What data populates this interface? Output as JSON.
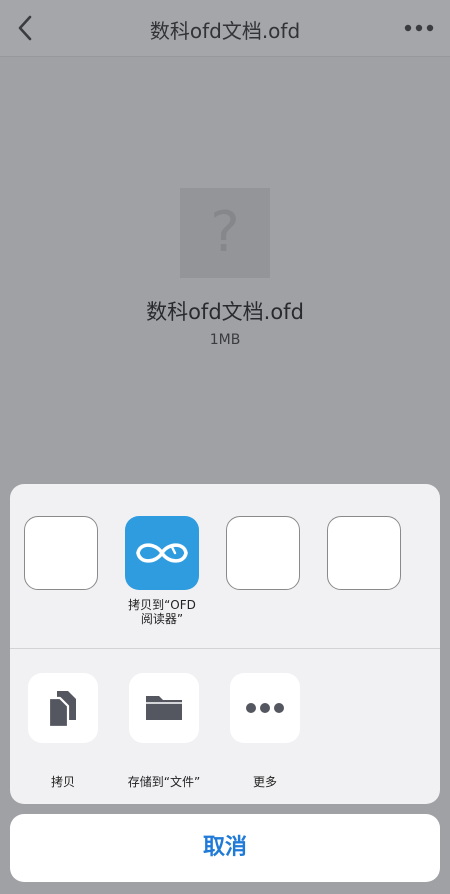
{
  "navbar": {
    "title": "数科ofd文档.ofd",
    "back_icon": "chevron-left-icon",
    "more_icon": "ellipsis-icon"
  },
  "file": {
    "name": "数科ofd文档.ofd",
    "size": "1MB",
    "preview_icon": "question-mark-icon"
  },
  "share_sheet": {
    "apps": [
      {
        "label": "",
        "icon": "blank-app-icon"
      },
      {
        "label": "拷贝到“OFD\n阅读器”",
        "icon": "ofd-reader-app-icon",
        "color": "#2f9ce0"
      },
      {
        "label": "",
        "icon": "blank-app-icon"
      },
      {
        "label": "",
        "icon": "blank-app-icon"
      }
    ],
    "actions": [
      {
        "label": "拷贝",
        "icon": "copy-icon"
      },
      {
        "label": "存储到“文件”",
        "icon": "folder-icon"
      },
      {
        "label": "更多",
        "icon": "ellipsis-icon"
      }
    ]
  },
  "cancel_label": "取消",
  "colors": {
    "accent": "#1f7ad8",
    "ofd_app": "#2f9ce0",
    "icon_dark": "#545660"
  }
}
